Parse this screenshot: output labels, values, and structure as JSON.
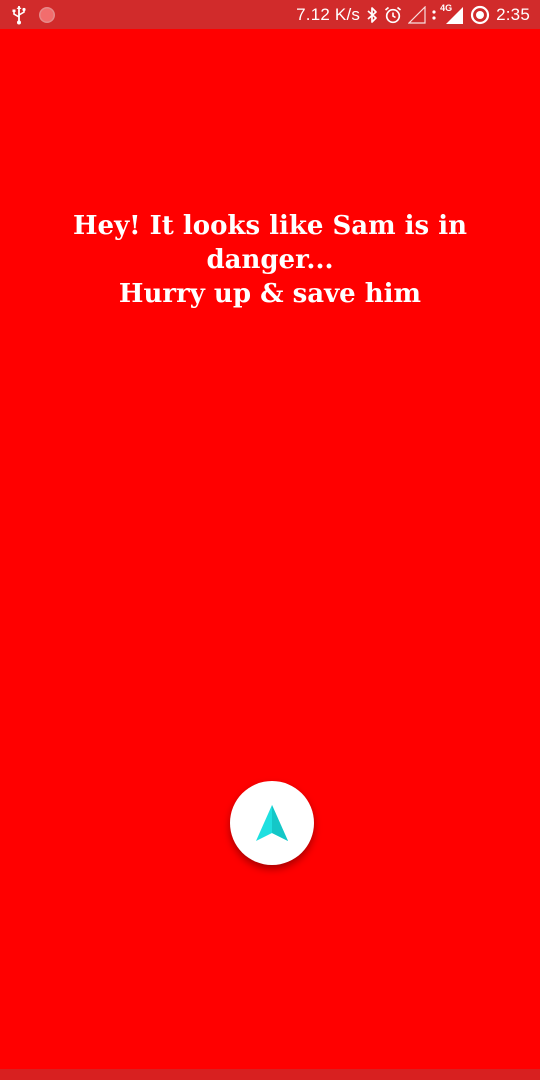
{
  "status_bar": {
    "network_speed": "7.12 K/s",
    "network_type": "4G",
    "time": "2:35",
    "icons": [
      "usb-icon",
      "record-icon",
      "bluetooth-icon",
      "alarm-icon",
      "signal-empty-icon",
      "signal-4g-icon",
      "battery-icon"
    ]
  },
  "main": {
    "message_lines": [
      "Hey! It looks like Sam is in",
      "danger...",
      "Hurry up & save him"
    ],
    "background_color": "#ff0000"
  },
  "fab": {
    "icon": "navigation-arrow-icon",
    "icon_color": "#1ee0e0"
  }
}
